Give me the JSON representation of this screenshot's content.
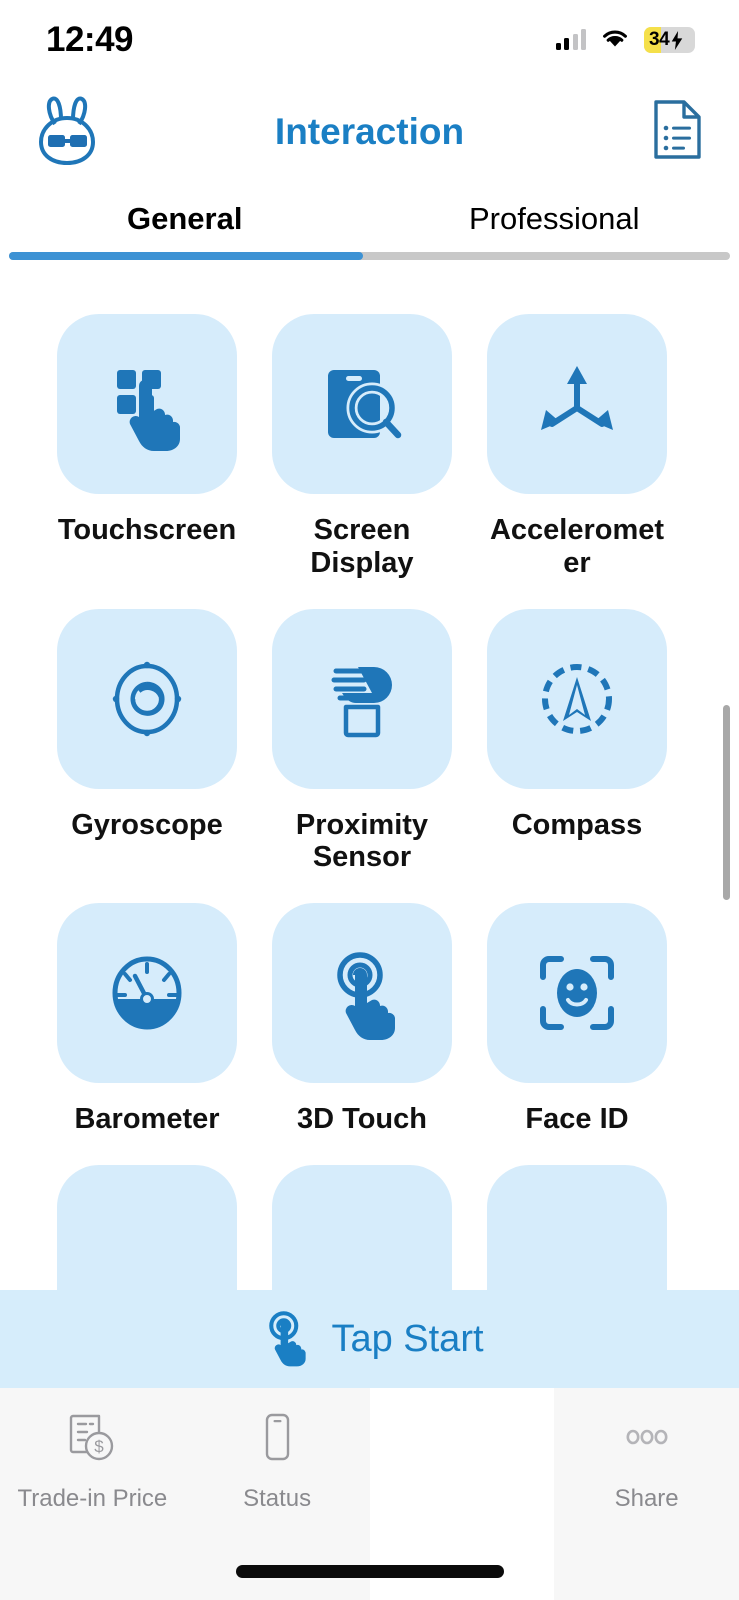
{
  "statusbar": {
    "time": "12:49",
    "signal_icon": "cellular-signal-icon",
    "wifi_icon": "wifi-icon",
    "battery": {
      "level_label": "34",
      "charging": true,
      "fill_color": "#f5e04a",
      "icon": "battery-charging-icon"
    }
  },
  "navbar": {
    "left_icon": "rabbit-mascot-icon",
    "title": "Interaction",
    "right_icon": "report-document-icon"
  },
  "tabs": {
    "items": [
      {
        "label": "General",
        "active": true
      },
      {
        "label": "Professional",
        "active": false
      }
    ],
    "indicator_color": "#3d92d4",
    "track_color": "#c8c8c8"
  },
  "grid": {
    "tile_color": "#d6ecfb",
    "icon_color": "#1f76b8",
    "items": [
      {
        "label": "Touchscreen",
        "icon": "touchscreen-icon"
      },
      {
        "label": "Screen Display",
        "icon": "screen-display-icon"
      },
      {
        "label": "Accelerometer",
        "icon": "accelerometer-icon"
      },
      {
        "label": "Gyroscope",
        "icon": "gyroscope-icon"
      },
      {
        "label": "Proximity Sensor",
        "icon": "proximity-sensor-icon"
      },
      {
        "label": "Compass",
        "icon": "compass-icon"
      },
      {
        "label": "Barometer",
        "icon": "barometer-icon"
      },
      {
        "label": "3D Touch",
        "icon": "three-d-touch-icon"
      },
      {
        "label": "Face ID",
        "icon": "face-id-icon"
      }
    ]
  },
  "tapstart": {
    "label": "Tap Start",
    "icon": "tap-hand-icon",
    "background": "#d6edfb",
    "text_color": "#1a7fc4"
  },
  "bottombar": {
    "items": [
      {
        "label": "Trade-in Price",
        "icon": "receipt-dollar-icon",
        "blank": false
      },
      {
        "label": "Status",
        "icon": "phone-outline-icon",
        "blank": false
      },
      {
        "label": "",
        "icon": "",
        "blank": true
      },
      {
        "label": "Share",
        "icon": "three-dots-icon",
        "blank": false
      }
    ]
  }
}
